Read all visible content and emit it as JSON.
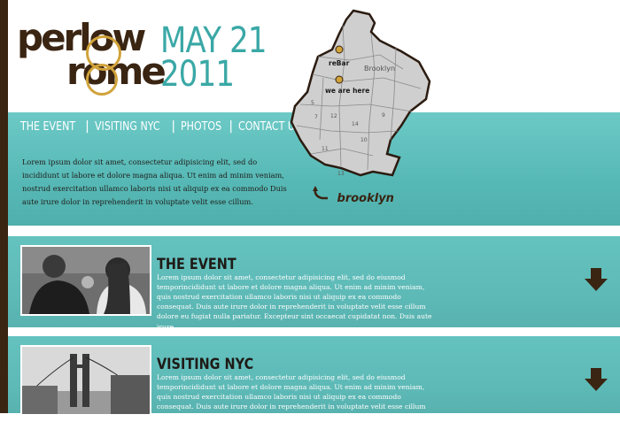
{
  "logo": {
    "line1": "perlow",
    "line2": "rome"
  },
  "date": {
    "line1": "MAY 21",
    "line2": "2011"
  },
  "nav": [
    "THE EVENT",
    "VISITING NYC",
    "PHOTOS",
    "CONTACT US"
  ],
  "intro": "Lorem ipsum dolor sit amet, consectetur adipisicing elit, sed do incididunt ut labore et dolore magna aliqua. Ut enim ad minim veniam, nostrud exercitation ullamco laboris nisi ut aliquip ex ea commodo Duis aute irure dolor in reprehenderit in voluptate velit esse cillum.",
  "map": {
    "label_rebar": "reBar",
    "label_brooklyn": "Brooklyn",
    "label_here": "we are here",
    "numbers": [
      "5",
      "7",
      "12",
      "14",
      "10",
      "11",
      "13",
      "9"
    ],
    "caption": "brooklyn"
  },
  "sections": [
    {
      "title": "THE EVENT",
      "body": "Lorem ipsum dolor sit amet, consectetur adipisicing elit, sed do eiusmod temporincididunt ut labore et dolore magna aliqua. Ut enim ad minim veniam, quis nostrud exercitation ullamco laboris nisi ut aliquip ex ea commodo consequat. Duis aute irure dolor in reprehenderit in voluptate velit esse cillum dolore eu fugiat nulla pariatur. Excepteur sint occaecat cupidatat non. Duis aute irure."
    },
    {
      "title": "VISITING NYC",
      "body": "Lorem ipsum dolor sit amet, consectetur adipisicing elit, sed do eiusmod temporincididunt ut labore et dolore magna aliqua. Ut enim ad minim veniam, quis nostrud exercitation ullamco laboris nisi ut aliquip ex ea commodo consequat. Duis aute irure dolor in reprehenderit in voluptate velit esse cillum dolore eu fugiat nulla pariatur. Excepteur sint"
    }
  ],
  "colors": {
    "teal": "#5dbcb9",
    "brown": "#3a2412",
    "gold": "#d1a33b"
  }
}
